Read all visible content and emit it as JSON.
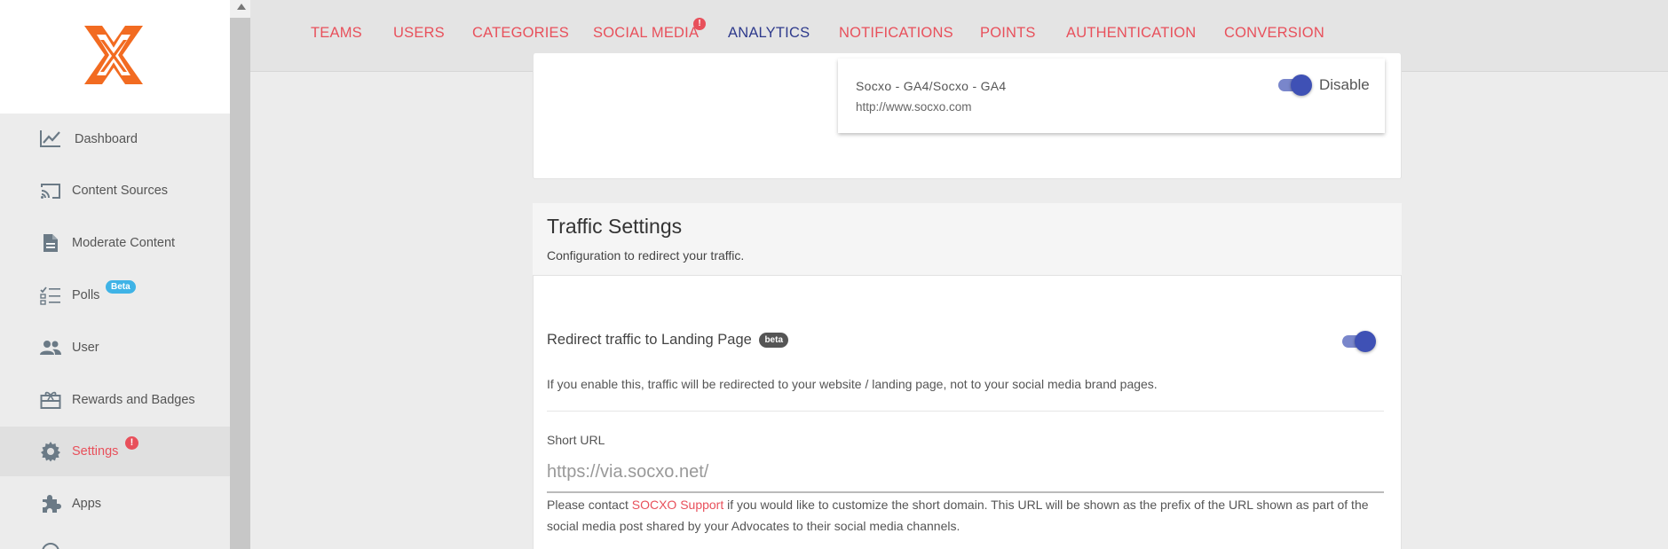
{
  "sidebar": {
    "items": [
      {
        "label": "Dashboard",
        "icon": "trending-up-icon"
      },
      {
        "label": "Content Sources",
        "icon": "cast-icon"
      },
      {
        "label": "Moderate Content",
        "icon": "document-icon"
      },
      {
        "label": "Polls",
        "icon": "checklist-icon",
        "badge": "Beta"
      },
      {
        "label": "User",
        "icon": "people-icon"
      },
      {
        "label": "Rewards and Badges",
        "icon": "gift-card-icon"
      },
      {
        "label": "Settings",
        "icon": "gear-icon",
        "alert": "!"
      },
      {
        "label": "Apps",
        "icon": "puzzle-icon"
      }
    ]
  },
  "tabs": [
    {
      "label": "TEAMS"
    },
    {
      "label": "USERS"
    },
    {
      "label": "CATEGORIES"
    },
    {
      "label": "SOCIAL MEDIA",
      "alert": "!"
    },
    {
      "label": "ANALYTICS",
      "active": true
    },
    {
      "label": "NOTIFICATIONS"
    },
    {
      "label": "POINTS"
    },
    {
      "label": "AUTHENTICATION"
    },
    {
      "label": "CONVERSION"
    }
  ],
  "analytics_account": {
    "name": "Socxo - GA4/Socxo - GA4",
    "url": "http://www.socxo.com",
    "toggle_label": "Disable",
    "enabled": true
  },
  "traffic": {
    "title": "Traffic Settings",
    "subtitle": "Configuration to redirect your traffic.",
    "redirect_label": "Redirect traffic to Landing Page",
    "redirect_badge": "beta",
    "redirect_enabled": true,
    "redirect_help": "If you enable this, traffic will be redirected to your website / landing page, not to your social media brand pages.",
    "short_url_label": "Short URL",
    "short_url_value": "https://via.socxo.net/",
    "help_prefix": "Please contact ",
    "help_link": "SOCXO Support",
    "help_suffix": " if you would like to customize the short domain. This URL will be shown as the prefix of the URL shown as part of the",
    "help_line2": "social media post shared by your Advocates to their social media channels."
  },
  "colors": {
    "accent": "#e8505b",
    "primary": "#2e3a8c",
    "toggle": "#3f51b5",
    "beta": "#3fb3e6"
  }
}
